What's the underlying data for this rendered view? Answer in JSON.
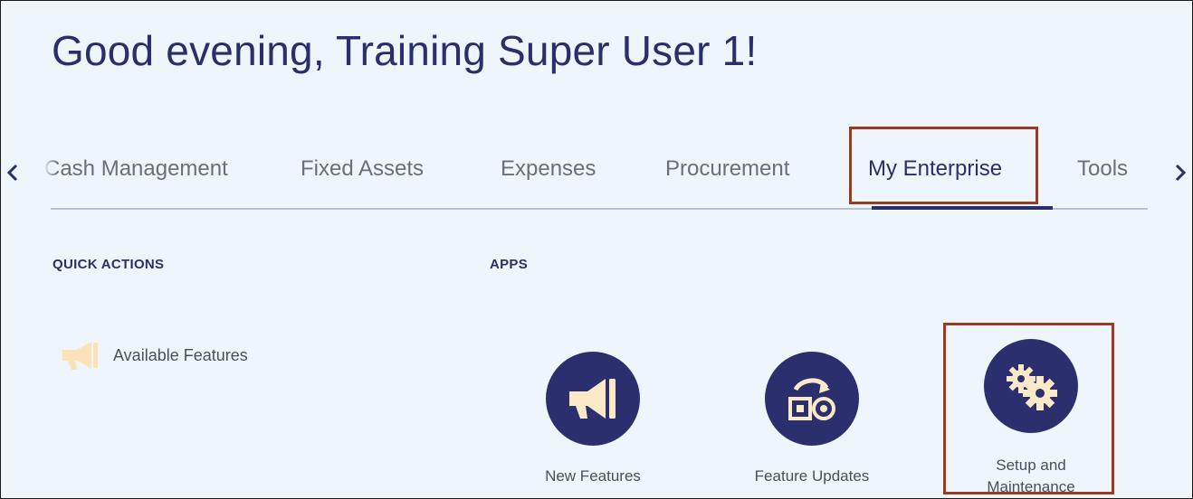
{
  "greeting": "Good evening, Training Super User 1!",
  "tabs": [
    {
      "label": "Cash Management"
    },
    {
      "label": "Fixed Assets"
    },
    {
      "label": "Expenses"
    },
    {
      "label": "Procurement"
    },
    {
      "label": "My Enterprise",
      "selected": true
    },
    {
      "label": "Tools"
    }
  ],
  "nav": {
    "prev_icon": "chevron-left-icon",
    "next_icon": "chevron-right-icon"
  },
  "quick_actions": {
    "title": "QUICK ACTIONS",
    "items": [
      {
        "label": "Available Features",
        "icon": "megaphone-icon"
      }
    ]
  },
  "apps": {
    "title": "APPS",
    "items": [
      {
        "label": "New Features",
        "icon": "megaphone-icon"
      },
      {
        "label": "Feature Updates",
        "icon": "feature-updates-icon"
      },
      {
        "label_line1": "Setup and",
        "label_line2": "Maintenance",
        "icon": "gears-icon"
      }
    ]
  },
  "colors": {
    "background": "#eef6fb",
    "brand_navy": "#2b2f6e",
    "icon_cream": "#fbe9c8",
    "highlight": "#9c3a22"
  }
}
